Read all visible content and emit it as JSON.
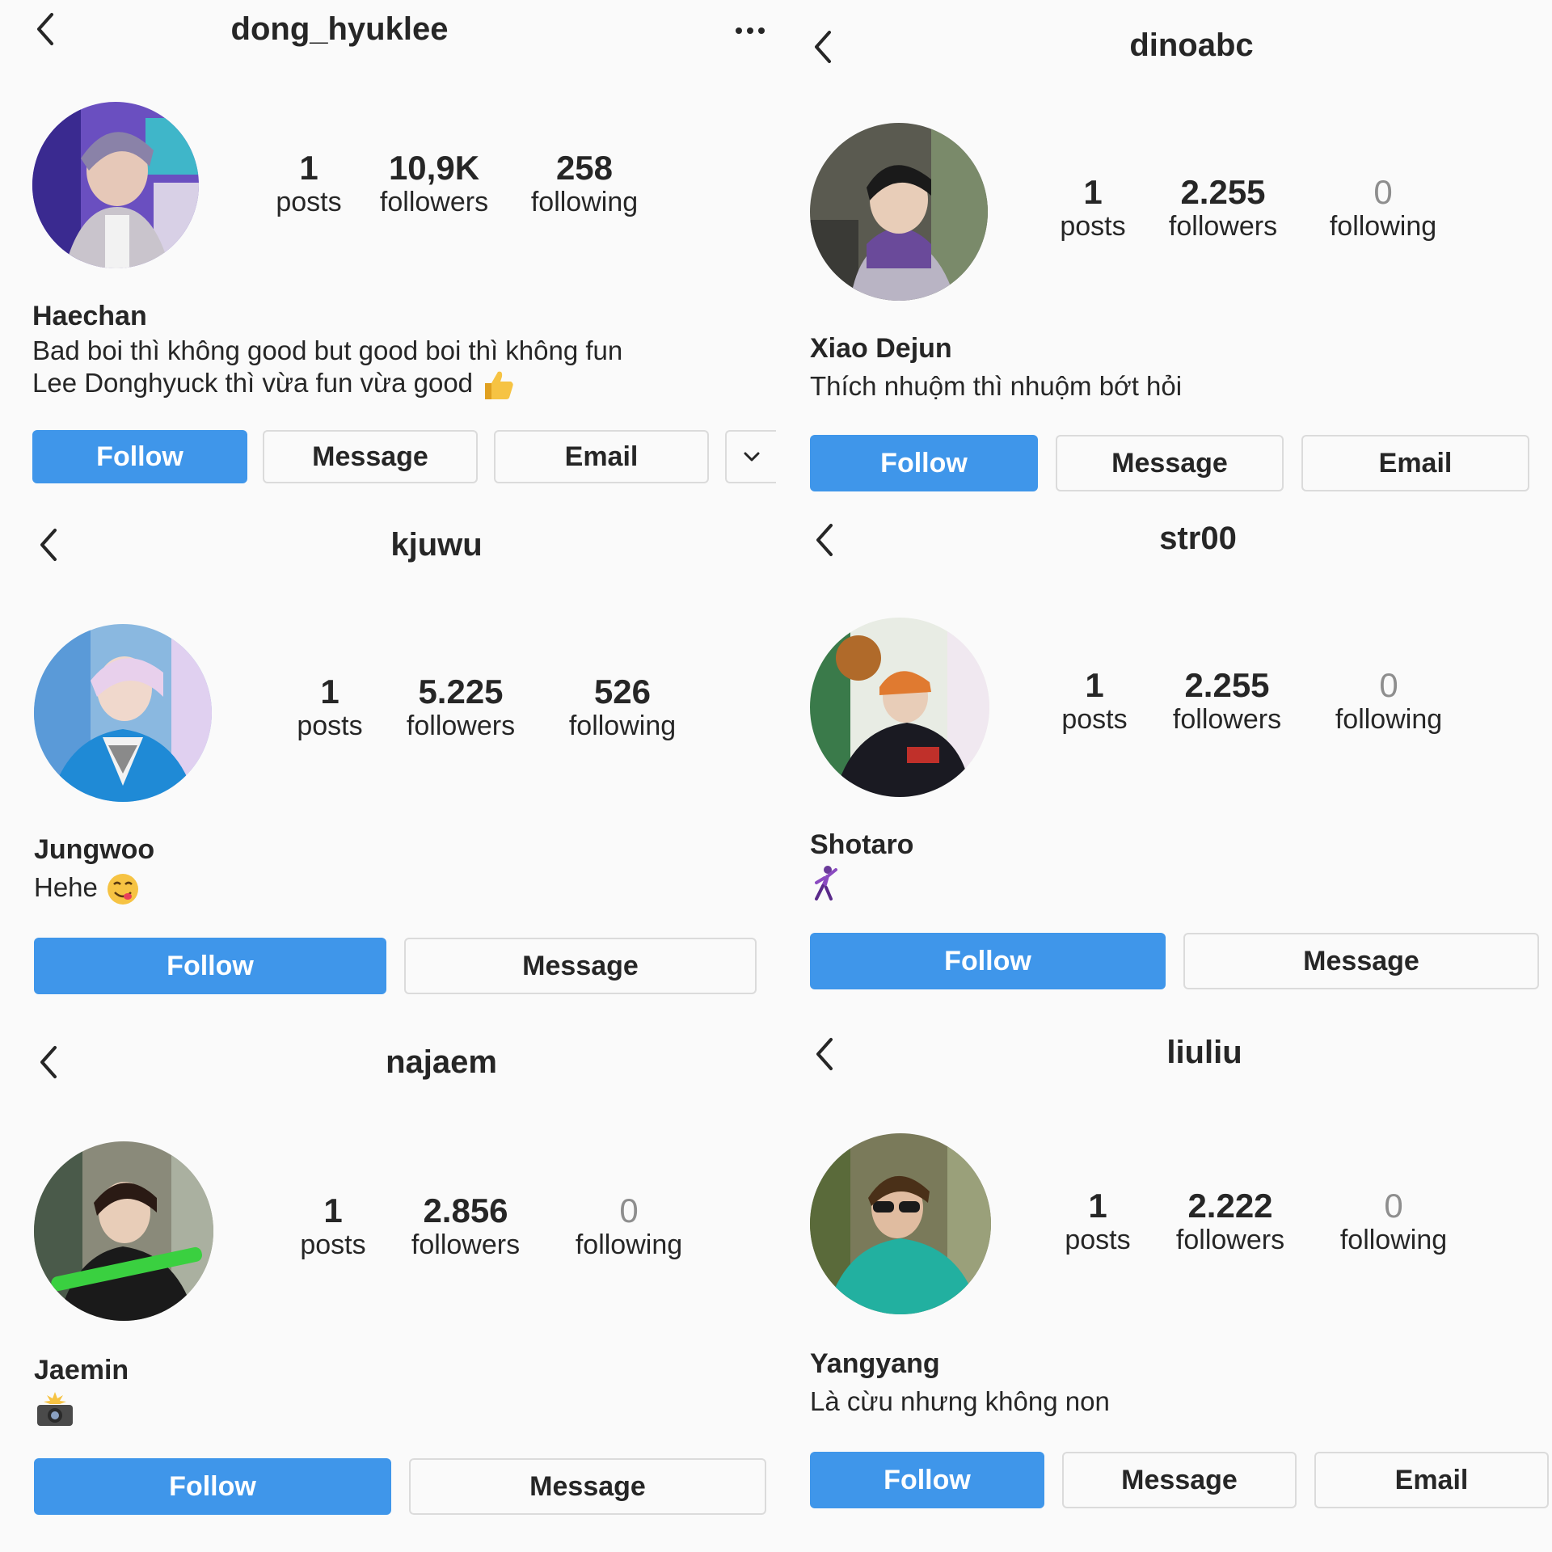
{
  "colors": {
    "follow": "#3f96ea",
    "border": "#dbdbdb",
    "text": "#262626",
    "muted": "#8e8e8e"
  },
  "profiles": [
    {
      "username": "dong_hyuklee",
      "posts": "1",
      "posts_label": "posts",
      "followers": "10,9K",
      "followers_label": "followers",
      "following": "258",
      "following_label": "following",
      "name": "Haechan",
      "bio_line1": "Bad boi thì không good but good boi thì không fun",
      "bio_line2": "Lee Donghyuck thì vừa fun vừa good",
      "bio_icon": "thumbs-up-icon",
      "follow_label": "Follow",
      "message_label": "Message",
      "email_label": "Email"
    },
    {
      "username": "dinoabc",
      "posts": "1",
      "posts_label": "posts",
      "followers": "2.255",
      "followers_label": "followers",
      "following": "0",
      "following_label": "following",
      "name": "Xiao Dejun",
      "bio_line1": "Thích nhuộm thì nhuộm bớt hỏi",
      "follow_label": "Follow",
      "message_label": "Message",
      "email_label": "Email"
    },
    {
      "username": "kjuwu",
      "posts": "1",
      "posts_label": "posts",
      "followers": "5.225",
      "followers_label": "followers",
      "following": "526",
      "following_label": "following",
      "name": "Jungwoo",
      "bio_line1": "Hehe",
      "bio_icon": "yum-face-icon",
      "follow_label": "Follow",
      "message_label": "Message"
    },
    {
      "username": "str00",
      "posts": "1",
      "posts_label": "posts",
      "followers": "2.255",
      "followers_label": "followers",
      "following": "0",
      "following_label": "following",
      "name": "Shotaro",
      "bio_icon": "dancer-icon",
      "follow_label": "Follow",
      "message_label": "Message"
    },
    {
      "username": "najaem",
      "posts": "1",
      "posts_label": "posts",
      "followers": "2.856",
      "followers_label": "followers",
      "following": "0",
      "following_label": "following",
      "name": "Jaemin",
      "bio_icon": "camera-flash-icon",
      "follow_label": "Follow",
      "message_label": "Message"
    },
    {
      "username": "liuliu",
      "posts": "1",
      "posts_label": "posts",
      "followers": "2.222",
      "followers_label": "followers",
      "following": "0",
      "following_label": "following",
      "name": "Yangyang",
      "bio_line1": "Là cừu nhưng không non",
      "follow_label": "Follow",
      "message_label": "Message",
      "email_label": "Email"
    }
  ]
}
